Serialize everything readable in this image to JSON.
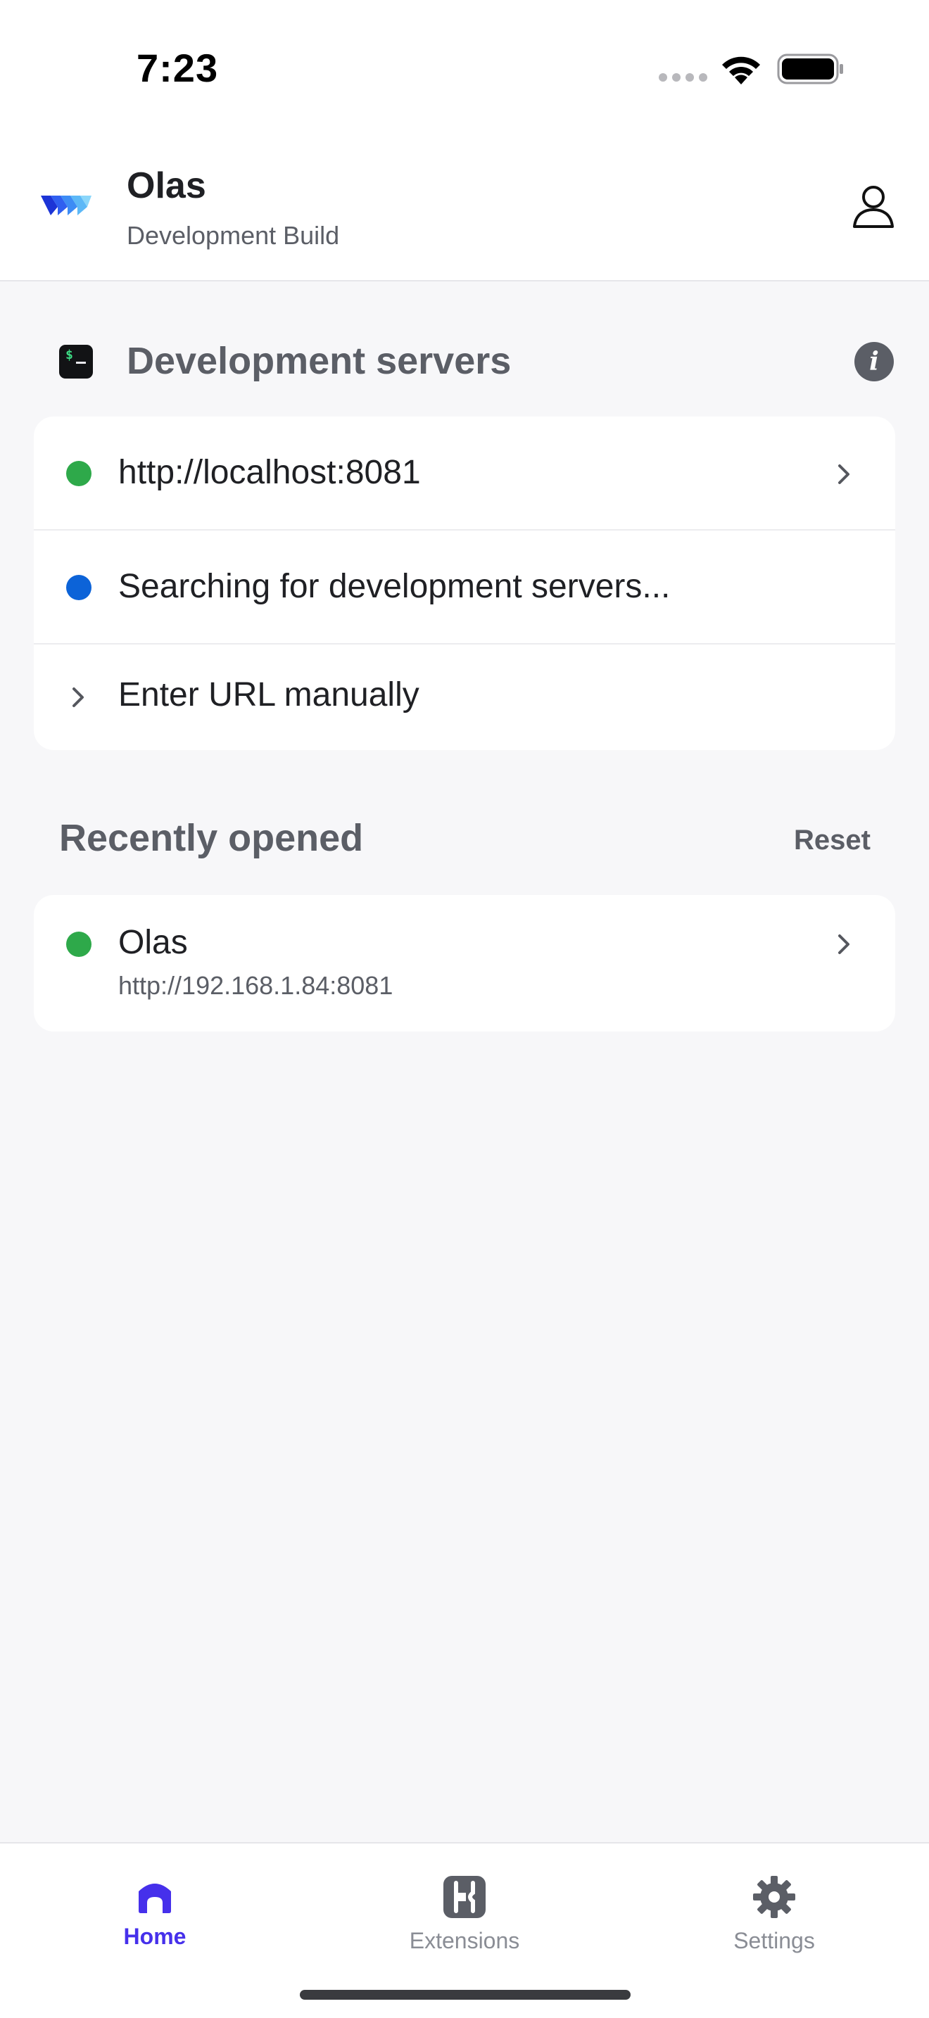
{
  "status_bar": {
    "time": "7:23"
  },
  "header": {
    "title": "Olas",
    "subtitle": "Development Build",
    "logo_icon": "olas-logo-icon",
    "profile_icon": "user-icon"
  },
  "dev_servers": {
    "title": "Development servers",
    "items": [
      {
        "label": "http://localhost:8081",
        "status_color": "#2ea94a"
      },
      {
        "label": "Searching for development servers...",
        "status_color": "#0c63d8"
      },
      {
        "label": "Enter URL manually"
      }
    ]
  },
  "recent": {
    "title": "Recently opened",
    "reset_label": "Reset",
    "items": [
      {
        "name": "Olas",
        "url": "http://192.168.1.84:8081",
        "status_color": "#2ea94a"
      }
    ]
  },
  "tab_bar": {
    "tabs": [
      {
        "label": "Home",
        "icon": "home-icon",
        "active": true
      },
      {
        "label": "Extensions",
        "icon": "extensions-icon",
        "active": false
      },
      {
        "label": "Settings",
        "icon": "gear-icon",
        "active": false
      }
    ]
  },
  "colors": {
    "accent": "#4630eb",
    "background": "#f7f7f9",
    "text_muted": "#5b5e66"
  }
}
